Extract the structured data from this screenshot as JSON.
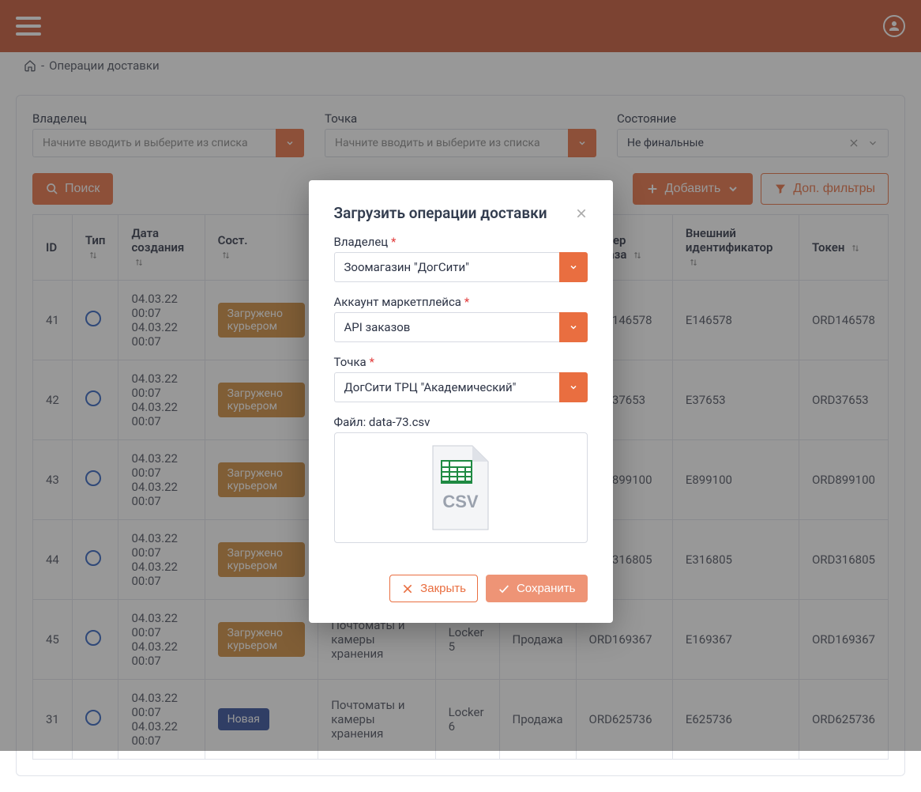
{
  "breadcrumb": {
    "page": "Операции доставки"
  },
  "filters": {
    "owner_label": "Владелец",
    "owner_placeholder": "Начните вводить и выберите из списка",
    "point_label": "Точка",
    "point_placeholder": "Начните вводить и выберите из списка",
    "state_label": "Состояние",
    "state_value": "Не финальные"
  },
  "buttons": {
    "search": "Поиск",
    "add": "Добавить",
    "more_filters": "Доп. фильтры"
  },
  "table": {
    "headers": {
      "id": "ID",
      "type": "Тип",
      "created": "Дата создания",
      "state": "Сост.",
      "order_no": "Номер заказа",
      "ext_id": "Внешний идентификатор",
      "token": "Токен"
    },
    "rows": [
      {
        "id": "41",
        "d1": "04.03.22 00:07",
        "d2": "04.03.22 00:07",
        "state": "Загружено курьером",
        "state_cls": "orange",
        "order": "ORD146578",
        "ext": "E146578",
        "token": "ORD146578"
      },
      {
        "id": "42",
        "d1": "04.03.22 00:07",
        "d2": "04.03.22 00:07",
        "state": "Загружено курьером",
        "state_cls": "orange",
        "order": "ORD37653",
        "ext": "E37653",
        "token": "ORD37653"
      },
      {
        "id": "43",
        "d1": "04.03.22 00:07",
        "d2": "04.03.22 00:07",
        "state": "Загружено курьером",
        "state_cls": "orange",
        "order": "ORD899100",
        "ext": "E899100",
        "token": "ORD899100"
      },
      {
        "id": "44",
        "d1": "04.03.22 00:07",
        "d2": "04.03.22 00:07",
        "state": "Загружено курьером",
        "state_cls": "orange",
        "order": "ORD316805",
        "ext": "E316805",
        "token": "ORD316805"
      },
      {
        "id": "45",
        "d1": "04.03.22 00:07",
        "d2": "04.03.22 00:07",
        "state": "Загружено курьером",
        "state_cls": "orange",
        "point": "Почтоматы и камеры хранения",
        "locker": "Locker 5",
        "kind": "Продажа",
        "order": "ORD169367",
        "ext": "E169367",
        "token": "ORD169367"
      },
      {
        "id": "31",
        "d1": "04.03.22 00:07",
        "d2": "04.03.22 00:07",
        "state": "Новая",
        "state_cls": "blue",
        "point": "Почтоматы и камеры хранения",
        "locker": "Locker 6",
        "kind": "Продажа",
        "order": "ORD625736",
        "ext": "E625736",
        "token": "ORD625736"
      }
    ]
  },
  "modal": {
    "title": "Загрузить операции доставки",
    "owner_label": "Владелец",
    "owner_value": "Зоомагазин \"ДогСити\"",
    "account_label": "Аккаунт маркетплейса",
    "account_value": "API заказов",
    "point_label": "Точка",
    "point_value": "ДогСити ТРЦ \"Академический\"",
    "file_label": "Файл: data-73.csv",
    "close": "Закрыть",
    "save": "Сохранить"
  }
}
